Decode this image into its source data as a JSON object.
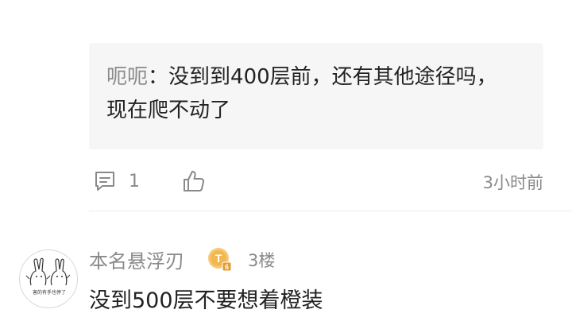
{
  "reply_quote": {
    "author": "呃呃",
    "separator": "：",
    "line1": "没到到400层前，还有其他途径吗，",
    "line2": "现在爬不动了"
  },
  "actions": {
    "comment_count": "1",
    "timestamp": "3小时前"
  },
  "post": {
    "username": "本名悬浮刃",
    "badge_letter": "T",
    "badge_level": "6",
    "floor": "3楼",
    "content": "没到500层不要想着橙装",
    "avatar_caption": "害的有手也停了"
  },
  "colors": {
    "quote_bg": "#f6f6f6",
    "muted_text": "#8a8a8a",
    "main_text": "#222222",
    "badge_gold": "#f2b74e"
  },
  "icons": {
    "comment": "comment-icon",
    "like": "thumbs-up-icon",
    "badge": "level-badge-icon"
  }
}
